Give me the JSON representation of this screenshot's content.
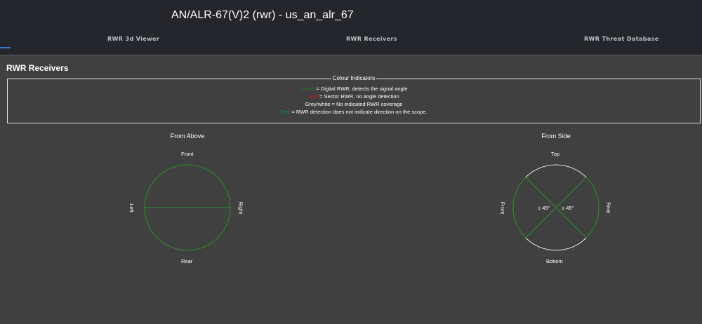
{
  "header": {
    "title": "AN/ALR-67(V)2 (rwr) - us_an_alr_67",
    "tabs": [
      {
        "label": "RWR 3d Viewer"
      },
      {
        "label": "RWR Receivers"
      },
      {
        "label": "RWR Threat Database"
      }
    ]
  },
  "section": {
    "title": "RWR Receivers"
  },
  "legend": {
    "title": "Colour Indicators",
    "items": [
      {
        "key": "Green",
        "text": " = Digital RWR, detects the signal angle",
        "color": "#1f7a1f"
      },
      {
        "key": "Red",
        "text": " = Sector RWR, no angle detection",
        "color": "#b02020"
      },
      {
        "key": "",
        "text": "Grey/white = No indicated RWR coverage",
        "color": "#ffffff"
      },
      {
        "key": "Teal",
        "text": " = RWR detection does not indicate direction on the scope.",
        "color": "#1e7b80"
      }
    ]
  },
  "diagrams": {
    "above": {
      "title": "From Above",
      "top": "Front",
      "bottom": "Rear",
      "left": "Left",
      "right": "Right",
      "circle_color": "#2e8b2e",
      "line_color": "#2e8b2e"
    },
    "side": {
      "title": "From Side",
      "top": "Top",
      "bottom": "Bottom",
      "left": "Front",
      "right": "Rear",
      "angle_left": "± 45°",
      "angle_right": "± 45°",
      "arc_left_color": "#2e8b2e",
      "arc_right_color": "#2e8b2e",
      "arc_other_color": "#e8e8e8",
      "line_color": "#2e8b2e"
    }
  }
}
